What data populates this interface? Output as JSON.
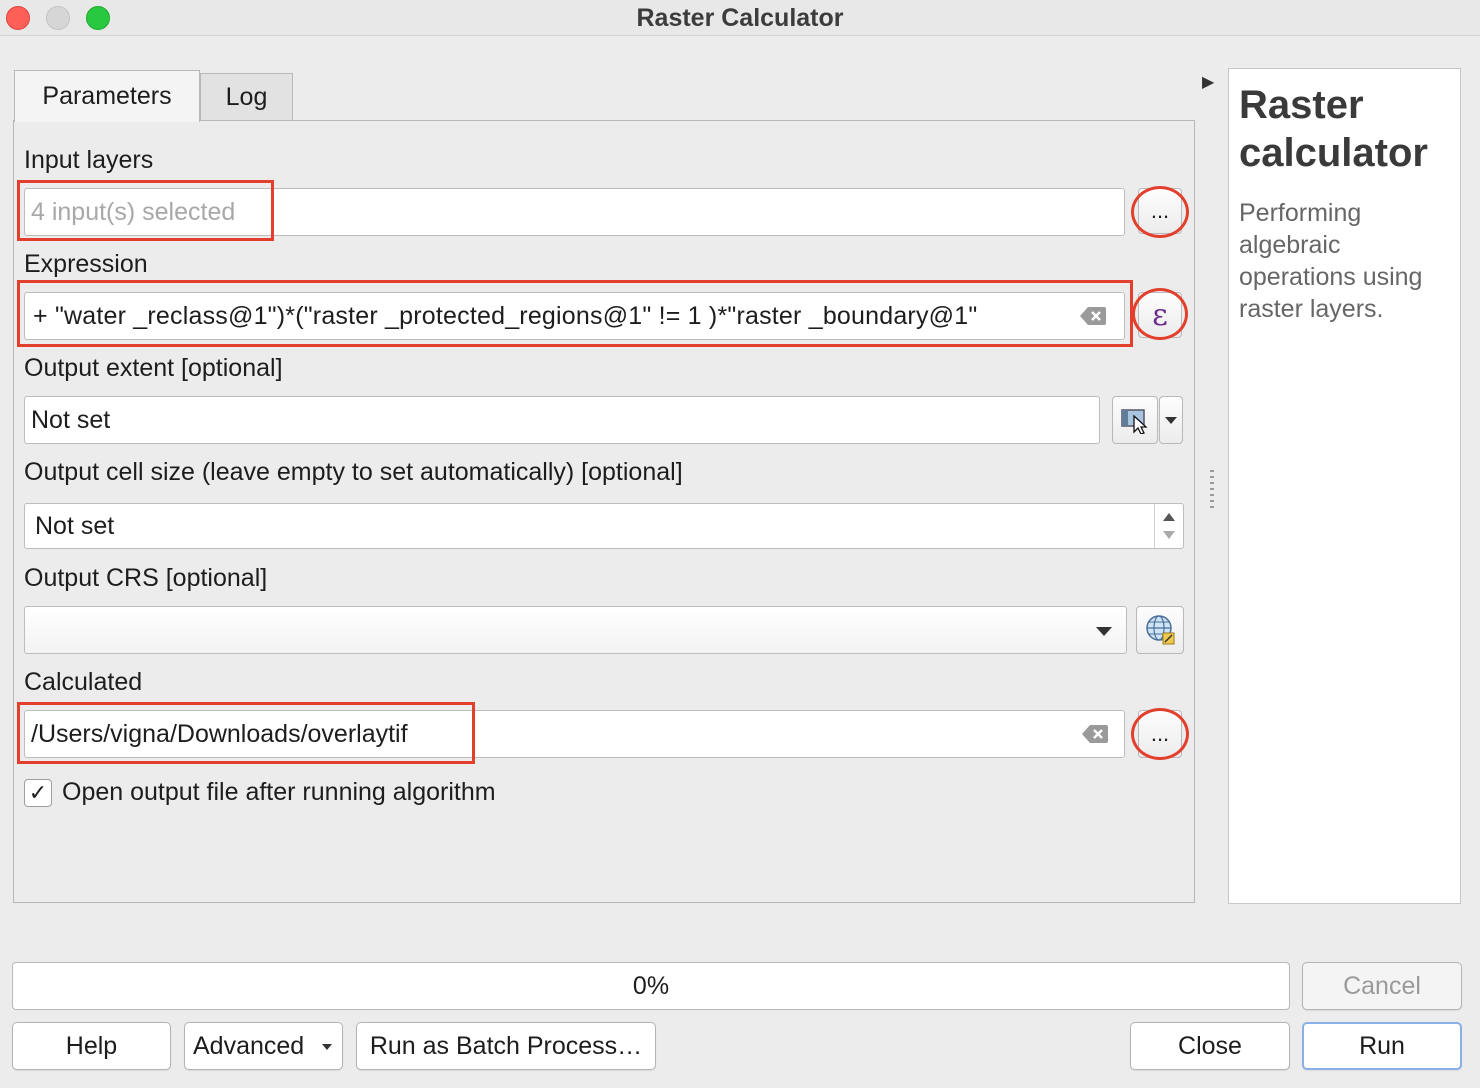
{
  "window": {
    "title": "Raster Calculator"
  },
  "tabs": [
    {
      "label": "Parameters"
    },
    {
      "label": "Log"
    }
  ],
  "params": {
    "input_layers": {
      "label": "Input layers",
      "placeholder": "4 input(s) selected",
      "button": "..."
    },
    "expression": {
      "label": "Expression",
      "value": "+ \"water _reclass@1\")*(\"raster _protected_regions@1\"  !=  1 )*\"raster _boundary@1\"",
      "button_glyph": "ε"
    },
    "output_extent": {
      "label": "Output extent [optional]",
      "value": "Not set"
    },
    "cell_size": {
      "label": "Output cell size (leave empty to set automatically) [optional]",
      "value": "Not set"
    },
    "output_crs": {
      "label": "Output CRS [optional]",
      "value": ""
    },
    "calculated": {
      "label": "Calculated",
      "value": "/Users/vigna/Downloads/overlaytif",
      "button": "..."
    },
    "open_output": {
      "label": "Open output file after running algorithm",
      "checked": true,
      "mark": "✓"
    }
  },
  "help": {
    "title": "Raster calculator",
    "description": "Performing algebraic operations using raster layers."
  },
  "progress": {
    "value": 0,
    "text": "0%"
  },
  "buttons": {
    "cancel": "Cancel",
    "help": "Help",
    "advanced": "Advanced",
    "batch": "Run as Batch Process…",
    "close": "Close",
    "run": "Run"
  },
  "icons": {
    "expander": "chevron-right-icon",
    "extent": "map-canvas-select-icon",
    "crs": "globe-crs-icon",
    "clear": "clear-backspace-icon"
  },
  "colors": {
    "annotation": "#e2402d",
    "accent": "#8ab0e6"
  }
}
